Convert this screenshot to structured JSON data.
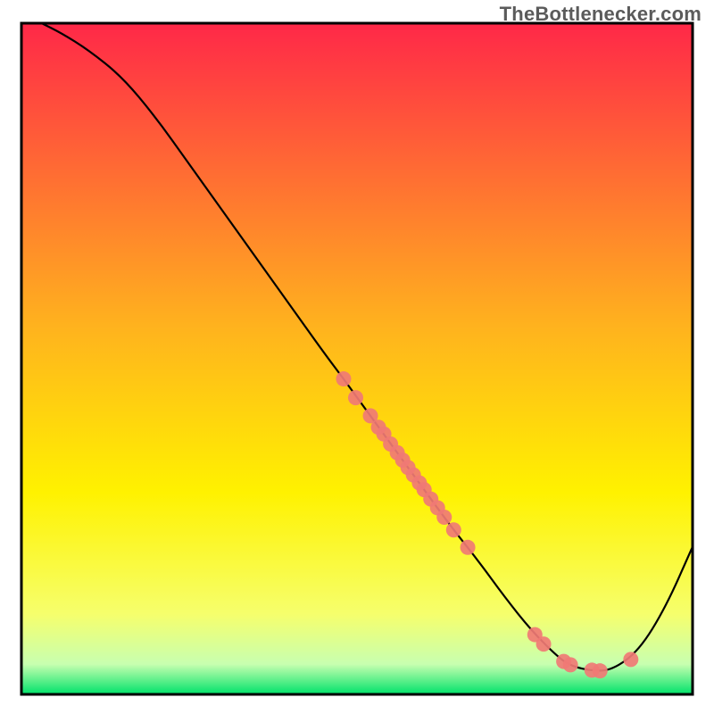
{
  "watermark": "TheBottlenecker.com",
  "chart_data": {
    "type": "line",
    "title": "",
    "xlabel": "",
    "ylabel": "",
    "xlim": [
      0,
      100
    ],
    "ylim": [
      0,
      100
    ],
    "legend": false,
    "background_gradient": {
      "stops": [
        {
          "offset": 0.0,
          "color": "#ff2848"
        },
        {
          "offset": 0.45,
          "color": "#ffb21e"
        },
        {
          "offset": 0.7,
          "color": "#fff200"
        },
        {
          "offset": 0.88,
          "color": "#f6ff6c"
        },
        {
          "offset": 0.955,
          "color": "#c8ffb0"
        },
        {
          "offset": 1.0,
          "color": "#00e26a"
        }
      ]
    },
    "series": [
      {
        "name": "bottleneck-curve",
        "color": "#000000",
        "stroke_width": 2.2,
        "x": [
          3,
          6,
          10,
          15,
          20,
          25,
          30,
          35,
          40,
          45,
          48,
          52,
          56,
          60,
          64,
          68,
          72,
          76,
          80,
          82,
          85,
          88,
          92,
          96,
          100
        ],
        "y": [
          100,
          98.5,
          96,
          92,
          86,
          79,
          72,
          65,
          58,
          51,
          47,
          41.5,
          36,
          30.5,
          25,
          20,
          14.5,
          9.5,
          5.5,
          4.2,
          3.5,
          3.6,
          6.5,
          13,
          22
        ]
      }
    ],
    "points": [
      {
        "series": "dots",
        "x": 48.0,
        "y": 47.0
      },
      {
        "series": "dots",
        "x": 49.8,
        "y": 44.2
      },
      {
        "series": "dots",
        "x": 52.0,
        "y": 41.5
      },
      {
        "series": "dots",
        "x": 53.2,
        "y": 39.8
      },
      {
        "series": "dots",
        "x": 54.0,
        "y": 38.8
      },
      {
        "series": "dots",
        "x": 55.0,
        "y": 37.3
      },
      {
        "series": "dots",
        "x": 56.0,
        "y": 36.0
      },
      {
        "series": "dots",
        "x": 56.8,
        "y": 34.9
      },
      {
        "series": "dots",
        "x": 57.6,
        "y": 33.8
      },
      {
        "series": "dots",
        "x": 58.4,
        "y": 32.7
      },
      {
        "series": "dots",
        "x": 59.3,
        "y": 31.5
      },
      {
        "series": "dots",
        "x": 60.0,
        "y": 30.5
      },
      {
        "series": "dots",
        "x": 61.0,
        "y": 29.1
      },
      {
        "series": "dots",
        "x": 62.0,
        "y": 27.8
      },
      {
        "series": "dots",
        "x": 63.0,
        "y": 26.4
      },
      {
        "series": "dots",
        "x": 64.4,
        "y": 24.5
      },
      {
        "series": "dots",
        "x": 66.5,
        "y": 21.9
      },
      {
        "series": "dots",
        "x": 76.5,
        "y": 8.9
      },
      {
        "series": "dots",
        "x": 77.8,
        "y": 7.5
      },
      {
        "series": "dots",
        "x": 80.8,
        "y": 4.9
      },
      {
        "series": "dots",
        "x": 81.8,
        "y": 4.4
      },
      {
        "series": "dots",
        "x": 85.0,
        "y": 3.6
      },
      {
        "series": "dots",
        "x": 86.2,
        "y": 3.5
      },
      {
        "series": "dots",
        "x": 90.8,
        "y": 5.2
      }
    ],
    "point_style": {
      "radius": 8.5,
      "fill": "#f07a75",
      "opacity": 0.92
    }
  }
}
